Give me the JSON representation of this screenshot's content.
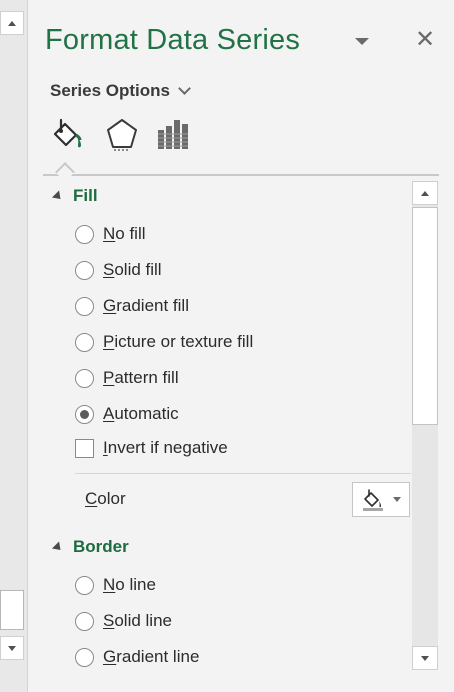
{
  "pane": {
    "title": "Format Data Series",
    "options_menu_icon": "triangle-down-icon",
    "close_icon": "close-icon",
    "series_options_label": "Series Options",
    "tabs": [
      {
        "name": "fill-line",
        "icon": "paint-bucket-icon"
      },
      {
        "name": "effects",
        "icon": "pentagon-icon"
      },
      {
        "name": "series-options",
        "icon": "bar-chart-icon"
      }
    ],
    "active_tab": "fill-line"
  },
  "fill": {
    "header": "Fill",
    "options": [
      {
        "label": "No fill",
        "key": "N",
        "rest": "o fill",
        "checked": false
      },
      {
        "label": "Solid fill",
        "key": "S",
        "rest": "olid fill",
        "checked": false
      },
      {
        "label": "Gradient fill",
        "key": "G",
        "rest": "radient fill",
        "checked": false
      },
      {
        "label": "Picture or texture fill",
        "key": "P",
        "rest": "icture or texture fill",
        "checked": false
      },
      {
        "label": "Pattern fill",
        "key": "P",
        "rest": "attern fill",
        "checked": false
      },
      {
        "label": "Automatic",
        "key": "A",
        "rest": "utomatic",
        "checked": true
      }
    ],
    "invert_label_key": "I",
    "invert_label_rest": "nvert if negative",
    "invert_checked": false,
    "color_key": "C",
    "color_rest": "olor",
    "color_swatch": "#a6a6a6"
  },
  "border": {
    "header": "Border",
    "options": [
      {
        "label": "No line",
        "key": "N",
        "rest": "o line",
        "checked": false
      },
      {
        "label": "Solid line",
        "key": "S",
        "rest": "olid line",
        "checked": false
      },
      {
        "label": "Gradient line",
        "key": "G",
        "rest": "radient line",
        "checked": false
      }
    ]
  },
  "colors": {
    "accent": "#217346",
    "section_header": "#1e6b40",
    "background": "#f3f3f3"
  }
}
